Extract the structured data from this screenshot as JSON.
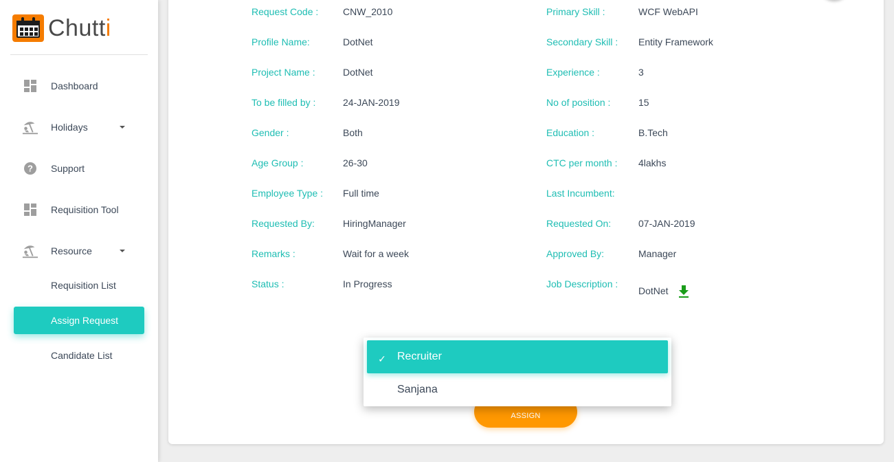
{
  "app": {
    "logo_main": "Chutt",
    "logo_accent": "i"
  },
  "sidebar": {
    "items": [
      {
        "label": "Dashboard",
        "icon": "dashboard-icon"
      },
      {
        "label": "Holidays",
        "icon": "beach-icon",
        "expandable": true
      },
      {
        "label": "Support",
        "icon": "help-icon"
      },
      {
        "label": "Requisition Tool",
        "icon": "dashboard-icon"
      },
      {
        "label": "Resource",
        "icon": "beach-icon",
        "expandable": true
      }
    ],
    "sub_items": [
      {
        "label": "Requisition List",
        "active": false
      },
      {
        "label": "Assign Request",
        "active": true
      },
      {
        "label": "Candidate List",
        "active": false
      }
    ]
  },
  "details": {
    "left": [
      {
        "label": "Request Code :",
        "value": "CNW_2010"
      },
      {
        "label": "Profile Name:",
        "value": "DotNet"
      },
      {
        "label": "Project Name :",
        "value": "DotNet"
      },
      {
        "label": "To be filled by :",
        "value": "24-JAN-2019"
      },
      {
        "label": "Gender :",
        "value": "Both"
      },
      {
        "label": "Age Group :",
        "value": "26-30"
      },
      {
        "label": "Employee Type :",
        "value": "Full time"
      },
      {
        "label": "Requested By:",
        "value": "HiringManager"
      },
      {
        "label": "Remarks :",
        "value": "Wait for a week"
      },
      {
        "label": "Status :",
        "value": "In Progress"
      }
    ],
    "right": [
      {
        "label": "Primary Skill :",
        "value": "WCF WebAPI"
      },
      {
        "label": "Secondary Skill :",
        "value": "Entity Framework"
      },
      {
        "label": "Experience :",
        "value": "3"
      },
      {
        "label": "No of position :",
        "value": "15"
      },
      {
        "label": "Education :",
        "value": "B.Tech"
      },
      {
        "label": "CTC per month :",
        "value": "4lakhs"
      },
      {
        "label": "Last Incumbent:",
        "value": ""
      },
      {
        "label": "Requested On:",
        "value": "07-JAN-2019"
      },
      {
        "label": "Approved By:",
        "value": "Manager"
      },
      {
        "label": "Job Description :",
        "value": "DotNet"
      }
    ]
  },
  "dropdown": {
    "options": [
      {
        "label": "Recruiter",
        "selected": true,
        "check": "✓"
      },
      {
        "label": "Sanjana",
        "selected": false
      }
    ]
  },
  "assign_button": "ASSIGN",
  "colors": {
    "accent": "#1ecbc0",
    "label": "#1ebdb3",
    "button": "#ff9800",
    "download": "#1a9d1a"
  }
}
